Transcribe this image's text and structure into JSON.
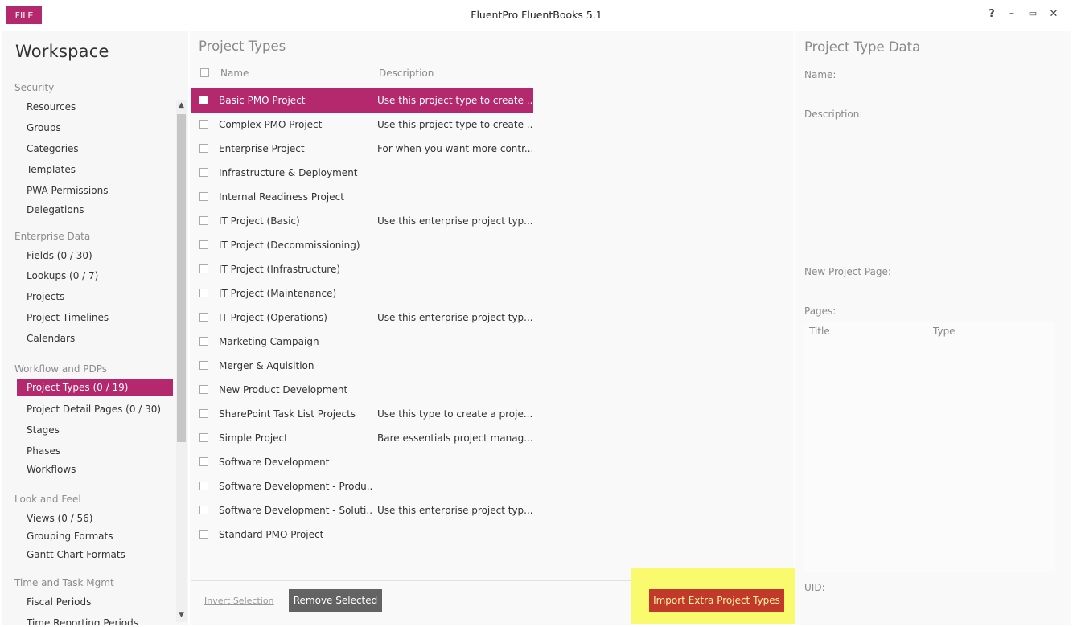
{
  "titlebar": {
    "file_label": "FILE",
    "app_title": "FluentPro FluentBooks 5.1",
    "help": "?",
    "minimize": "–",
    "restore": "▭",
    "close": "✕"
  },
  "sidebar": {
    "title": "Workspace",
    "groups": [
      {
        "label": "Security",
        "items": [
          "Resources",
          "Groups",
          "Categories",
          "Templates",
          "PWA Permissions",
          "Delegations"
        ]
      },
      {
        "label": "Enterprise Data",
        "items": [
          "Fields (0 / 30)",
          "Lookups (0 / 7)",
          "Projects",
          "Project Timelines",
          "Calendars"
        ]
      },
      {
        "label": "Workflow and PDPs",
        "items": [
          "Project Types (0 / 19)",
          "Project Detail Pages (0 / 30)",
          "Stages",
          "Phases",
          "Workflows"
        ]
      },
      {
        "label": "Look and Feel",
        "items": [
          "Views (0 / 56)",
          "Grouping Formats",
          "Gantt Chart Formats"
        ]
      },
      {
        "label": "Time and Task Mgmt",
        "items": [
          "Fiscal Periods",
          "Time Reporting Periods"
        ]
      }
    ],
    "active_item": "Project Types (0 / 19)"
  },
  "project_types": {
    "title": "Project Types",
    "col_name": "Name",
    "col_description": "Description",
    "rows": [
      {
        "name": "Basic PMO Project",
        "description": "Use this project type to create ...",
        "selected": true
      },
      {
        "name": "Complex PMO Project",
        "description": "Use this project type to create ..."
      },
      {
        "name": "Enterprise Project",
        "description": "For when you want more contr..."
      },
      {
        "name": "Infrastructure & Deployment",
        "description": ""
      },
      {
        "name": "Internal Readiness  Project",
        "description": ""
      },
      {
        "name": "IT Project (Basic)",
        "description": "Use this enterprise project typ..."
      },
      {
        "name": "IT Project (Decommissioning)",
        "description": ""
      },
      {
        "name": "IT Project (Infrastructure)",
        "description": ""
      },
      {
        "name": "IT Project (Maintenance)",
        "description": ""
      },
      {
        "name": "IT Project (Operations)",
        "description": "Use this enterprise project typ..."
      },
      {
        "name": "Marketing Campaign",
        "description": ""
      },
      {
        "name": "Merger & Aquisition",
        "description": ""
      },
      {
        "name": "New Product Development",
        "description": ""
      },
      {
        "name": "SharePoint Task List Projects",
        "description": "Use this type to create a proje..."
      },
      {
        "name": "Simple Project",
        "description": "Bare essentials project manag..."
      },
      {
        "name": "Software Development",
        "description": ""
      },
      {
        "name": "Software Development - Produ...",
        "description": ""
      },
      {
        "name": "Software Development - Soluti...",
        "description": "Use this enterprise project typ..."
      },
      {
        "name": "Standard PMO Project",
        "description": ""
      }
    ],
    "invert_selection": "Invert Selection",
    "remove_selected": "Remove Selected",
    "import_extra": "Import Extra Project Types"
  },
  "project_type_data": {
    "title": "Project Type Data",
    "name_label": "Name:",
    "description_label": "Description:",
    "new_project_page_label": "New Project Page:",
    "pages_label": "Pages:",
    "pages_col_title": "Title",
    "pages_col_type": "Type",
    "uid_label": "UID:"
  },
  "colors": {
    "accent": "#b4286e",
    "import_button": "#c0392b",
    "highlight": "#fafa6e"
  }
}
